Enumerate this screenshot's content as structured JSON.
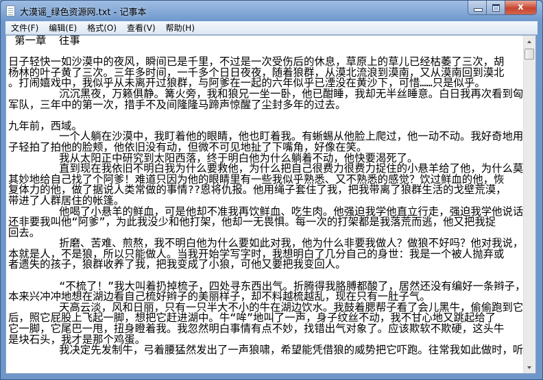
{
  "window": {
    "title": "大漠谣_绿色资源网.txt - 记事本",
    "close_glyph": "x"
  },
  "menu": [
    "文件(F)",
    "编辑(E)",
    "格式(O)",
    "查看(V)",
    "帮助(H)"
  ],
  "scroll": {
    "position_fraction": 0.0
  },
  "lines": [
    " 第一章  往事",
    "",
    "日子轻快一如沙漠中的夜风，瞬间已是千里，不过是一次受伤后的休息，草原上的草儿已经枯萎了三次，胡",
    "杨林的叶子黄了三次。三年多时间，一千多个日日夜夜，随着狼群，从漠北流浪到漠南，又从漠南回到漠北",
    "。打闹嬉戏中，我似乎从未离开过狼群，与阿爹在一起的六年似乎已湮没在黄沙下，可惜……只是似乎。",
    "        沉沉黑夜，万籁俱静。篝火旁，我和狼兄一坐一卧，他已酣睡，我却无半丝睡意。白日我再次看到匈奴",
    "军队，三年中的第一次，措手不及间隆隆马蹄声惊醒了尘封多年的过去。",
    "",
    "九年前，西域。",
    "        一个人躺在沙漠中，我盯着他的眼睛，他也盯着我。有蜥蜴从他脸上爬过，他一动不动。我好奇地用爪",
    "子轻拍了拍他的脸颊，他依旧没有动，但微不可见地扯了下嘴角，好像在笑。",
    "        我从太阳正中研究到太阳西落，终于明白他为什么躺着不动，他快要渴死了。",
    "        直到现在我依旧不明白我为什么要救他，为什么把自己很费力很费力捉住的小悬羊给了他，为什么莫名",
    "其妙地给自己找了个阿爹！难道只因为他的眼睛里有一些我似乎熟悉、又不熟悉的感觉？饮过鲜血的他，恢",
    "复体力的他，做了据说人类常做的事情??恩将仇报。他用绳子套住了我，把我带离了狼群生活的戈壁荒漠，",
    "带进了人群居住的帐篷。",
    "        他喝了小悬羊的鲜血，可是他却不准我再饮鲜血、吃生肉。他强迫我学他直立行走，强迫我学他说话，",
    "还非要我叫他“阿爹”，为此我没少和他打架，他却一无畏惧。每一次的打架都是我落荒而逃，他又把我捉",
    "回去。",
    "        折磨、苦难、煎熬，我不明白他为什么要如此对我，他为什么非要我做人？做狼不好吗？他对我说，我",
    "本就是人，不是狼，所以只能做人。当我开始学写字时，我想明白了几分自己的身世：我是一个被人抛弃或",
    "者遗失的孩子，狼群收养了我，把我变成了小狼，可他又要把我变回人。",
    "",
    "        “不梳了！”我大叫着扔掉梳子，四处寻东西出气。折腾得我胳膊都酸了，居然还没有编好一条辫子，",
    "本来兴冲冲地想在湖边看自己梳好辫子的美丽样子，却不料越梳越乱，现在只有一肚子气。",
    "        天高云淡，风和日丽，只有一只半大不小的牛在湖边饮水。我鼓着腮帮子看了会儿黑牛，偷偷跑到它身",
    "后，照它屁股上飞起一脚，想把它赶进湖中。牛“哞”地叫了一声，身子纹丝不动，我不甘心地又跳起给了",
    "它一脚，它尾巴一甩，扭身瞪着我。我忽然明白事情有点不妙，找错出气对象了。应该欺软不欺硬，这头牛",
    "是块石头，我才是那个鸡蛋。",
    "        我决定先发制牛，弓着腰猛然发出了一声狼啸，希望能凭借狼的威势把它吓跑。往常我如此做时，听到"
  ]
}
